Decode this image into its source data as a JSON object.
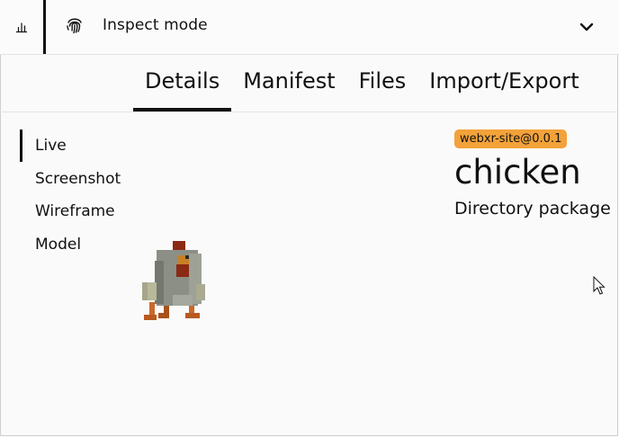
{
  "topbar": {
    "chart_icon": "bar-chart-icon",
    "mode_icon": "fingerprint-icon",
    "mode_label": "Inspect mode",
    "expand_icon": "chevron-down-icon"
  },
  "tabs": [
    {
      "label": "Details",
      "active": true
    },
    {
      "label": "Manifest",
      "active": false
    },
    {
      "label": "Files",
      "active": false
    },
    {
      "label": "Import/Export",
      "active": false
    }
  ],
  "sidenav": [
    {
      "label": "Live",
      "active": true
    },
    {
      "label": "Screenshot",
      "active": false
    },
    {
      "label": "Wireframe",
      "active": false
    },
    {
      "label": "Model",
      "active": false
    }
  ],
  "package": {
    "badge": "webxr-site@0.0.1",
    "badge_color": "#f3a23a",
    "name": "chicken",
    "type": "Directory package"
  }
}
